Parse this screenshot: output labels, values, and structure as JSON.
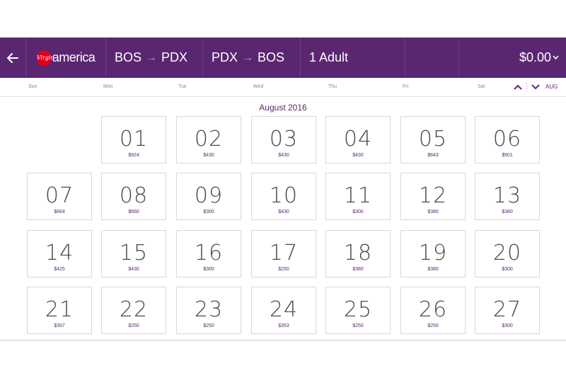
{
  "header": {
    "logo_text": "america",
    "logo_badge": "Virgin",
    "outbound": {
      "from": "BOS",
      "to": "PDX"
    },
    "return": {
      "from": "PDX",
      "to": "BOS"
    },
    "passengers": "1 Adult",
    "total": "$0.00",
    "brand_color": "#5a2670",
    "logo_color": "#e1001a"
  },
  "weekdays": [
    "Sun",
    "Mon",
    "Tue",
    "Wed",
    "Thu",
    "Fri",
    "Sat"
  ],
  "month_nav": {
    "label": "AUG"
  },
  "calendar": {
    "title": "August 2016",
    "rows": [
      [
        null,
        {
          "day": "01",
          "fare": "$924"
        },
        {
          "day": "02",
          "fare": "$430"
        },
        {
          "day": "03",
          "fare": "$430"
        },
        {
          "day": "04",
          "fare": "$430"
        },
        {
          "day": "05",
          "fare": "$643"
        },
        {
          "day": "06",
          "fare": "$501"
        }
      ],
      [
        {
          "day": "07",
          "fare": "$664"
        },
        {
          "day": "08",
          "fare": "$660"
        },
        {
          "day": "09",
          "fare": "$300"
        },
        {
          "day": "10",
          "fare": "$430"
        },
        {
          "day": "11",
          "fare": "$300"
        },
        {
          "day": "12",
          "fare": "$380"
        },
        {
          "day": "13",
          "fare": "$380"
        }
      ],
      [
        {
          "day": "14",
          "fare": "$425"
        },
        {
          "day": "15",
          "fare": "$430"
        },
        {
          "day": "16",
          "fare": "$300"
        },
        {
          "day": "17",
          "fare": "$250"
        },
        {
          "day": "18",
          "fare": "$380"
        },
        {
          "day": "19",
          "fare": "$380"
        },
        {
          "day": "20",
          "fare": "$300"
        }
      ],
      [
        {
          "day": "21",
          "fare": "$357"
        },
        {
          "day": "22",
          "fare": "$250"
        },
        {
          "day": "23",
          "fare": "$250"
        },
        {
          "day": "24",
          "fare": "$353"
        },
        {
          "day": "25",
          "fare": "$250"
        },
        {
          "day": "26",
          "fare": "$250"
        },
        {
          "day": "27",
          "fare": "$300"
        }
      ]
    ]
  }
}
